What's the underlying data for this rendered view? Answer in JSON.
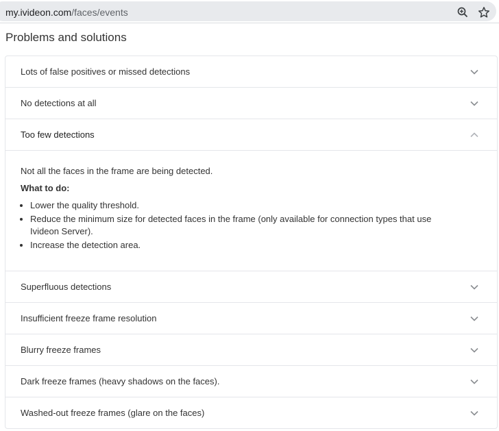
{
  "browser": {
    "url_host": "my.ivideon.com",
    "url_path": "/faces/events"
  },
  "section": {
    "title": "Problems and solutions"
  },
  "accordion": {
    "items": [
      {
        "label": "Lots of false positives or missed detections"
      },
      {
        "label": "No detections at all"
      },
      {
        "label": "Too few detections",
        "expanded": true,
        "description": "Not all the faces in the frame are being detected.",
        "what_to_do_label": "What to do:",
        "steps": [
          "Lower the quality threshold.",
          "Reduce the minimum size for detected faces in the frame (only available for connection types that use Ivideon Server).",
          "Increase the detection area."
        ]
      },
      {
        "label": "Superfluous detections"
      },
      {
        "label": "Insufficient freeze frame resolution"
      },
      {
        "label": "Blurry freeze frames"
      },
      {
        "label": "Dark freeze frames (heavy shadows on the faces)."
      },
      {
        "label": "Washed-out freeze frames (glare on the faces)"
      }
    ]
  },
  "icons": {
    "site": "site-info-icon",
    "zoom": "zoom-icon",
    "bookmark": "bookmark-star-icon",
    "collapsed": "chevron-down-icon",
    "expanded": "chevron-up-icon"
  }
}
